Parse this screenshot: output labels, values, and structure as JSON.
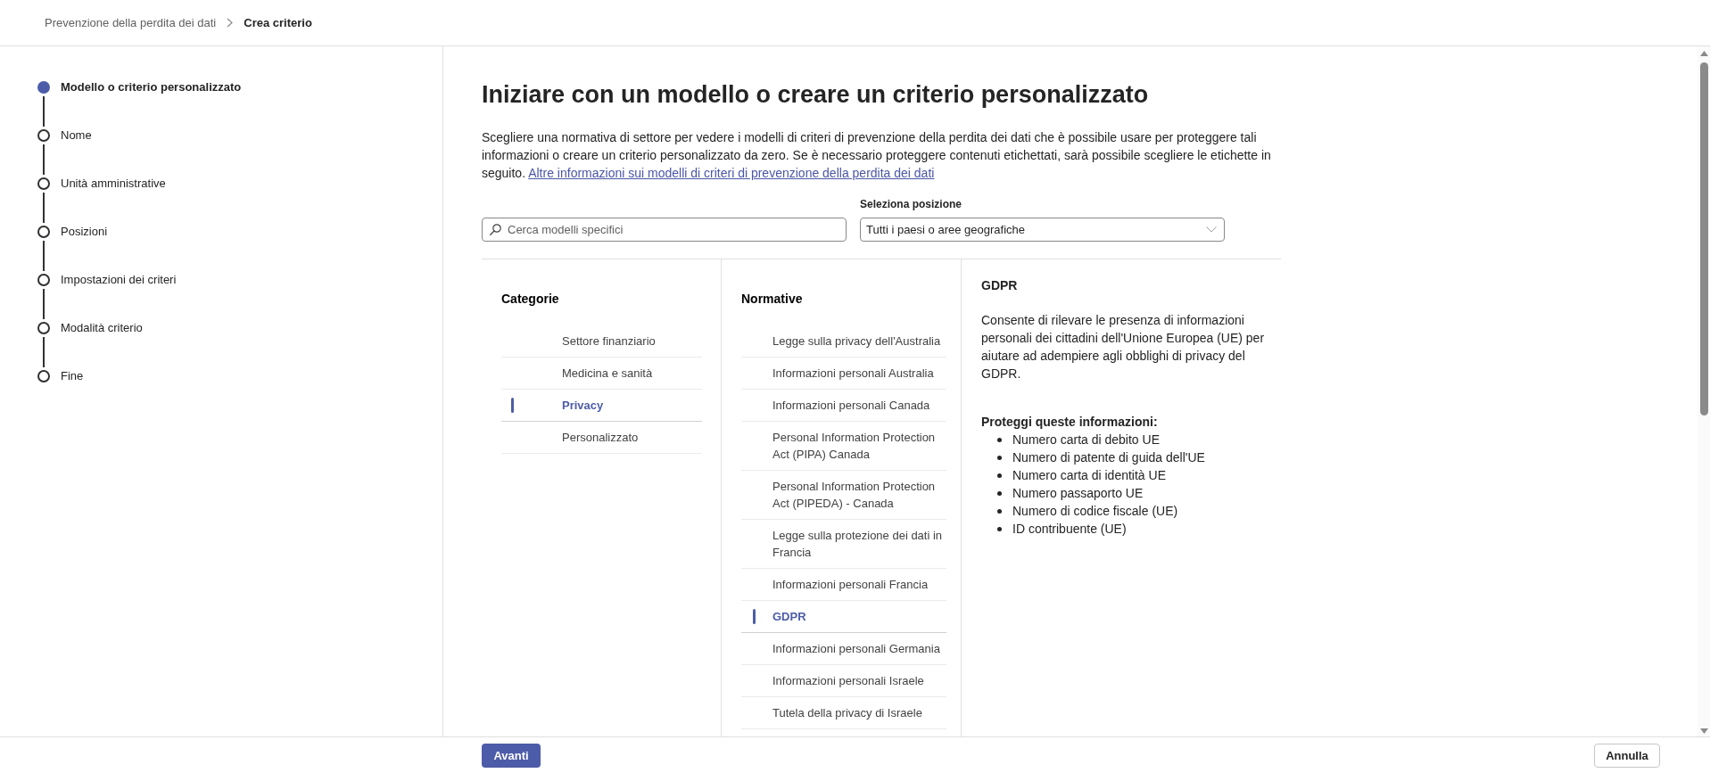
{
  "breadcrumb": [
    {
      "label": "Prevenzione della perdita dei dati",
      "current": false
    },
    {
      "label": "Crea criterio",
      "current": true
    }
  ],
  "steps": [
    {
      "label": "Modello o criterio personalizzato",
      "current": true
    },
    {
      "label": "Nome",
      "current": false
    },
    {
      "label": "Unità amministrative",
      "current": false
    },
    {
      "label": "Posizioni",
      "current": false
    },
    {
      "label": "Impostazioni dei criteri",
      "current": false
    },
    {
      "label": "Modalità criterio",
      "current": false
    },
    {
      "label": "Fine",
      "current": false
    }
  ],
  "page": {
    "title": "Iniziare con un modello o creare un criterio personalizzato",
    "description": "Scegliere una normativa di settore per vedere i modelli di criteri di prevenzione della perdita dei dati che è possibile usare per proteggere tali informazioni o creare un criterio personalizzato da zero. Se è necessario proteggere contenuti etichettati, sarà possibile scegliere le etichette in seguito.",
    "link": "Altre informazioni sui modelli di criteri di prevenzione della perdita dei dati"
  },
  "search": {
    "placeholder": "Cerca modelli specifici"
  },
  "location": {
    "label": "Seleziona posizione",
    "value": "Tutti i paesi o aree geografiche"
  },
  "categories": {
    "title": "Categorie",
    "items": [
      {
        "label": "Settore finanziario",
        "selected": false
      },
      {
        "label": "Medicina e sanità",
        "selected": false
      },
      {
        "label": "Privacy",
        "selected": true
      },
      {
        "label": "Personalizzato",
        "selected": false
      }
    ]
  },
  "regulations": {
    "title": "Normative",
    "items": [
      {
        "label": "Legge sulla privacy dell'Australia",
        "selected": false
      },
      {
        "label": "Informazioni personali Australia",
        "selected": false
      },
      {
        "label": "Informazioni personali Canada",
        "selected": false
      },
      {
        "label": "Personal Information Protection Act (PIPA) Canada",
        "selected": false
      },
      {
        "label": "Personal Information Protection Act (PIPEDA) - Canada",
        "selected": false
      },
      {
        "label": "Legge sulla protezione dei dati in Francia",
        "selected": false
      },
      {
        "label": "Informazioni personali Francia",
        "selected": false
      },
      {
        "label": "GDPR",
        "selected": true
      },
      {
        "label": "Informazioni personali Germania",
        "selected": false
      },
      {
        "label": "Informazioni personali Israele",
        "selected": false
      },
      {
        "label": "Tutela della privacy di Israele",
        "selected": false
      }
    ]
  },
  "details": {
    "title": "GDPR",
    "description": "Consente di rilevare le presenza di informazioni personali dei cittadini dell'Unione Europea (UE) per aiutare ad adempiere agli obblighi di privacy del GDPR.",
    "list_title": "Proteggi queste informazioni:",
    "items": [
      "Numero carta di debito UE",
      "Numero di patente di guida dell'UE",
      "Numero carta di identità UE",
      "Numero passaporto UE",
      "Numero di codice fiscale (UE)",
      "ID contribuente (UE)"
    ]
  },
  "footer": {
    "next_button": "Avanti",
    "cancel_button": "Annulla"
  }
}
